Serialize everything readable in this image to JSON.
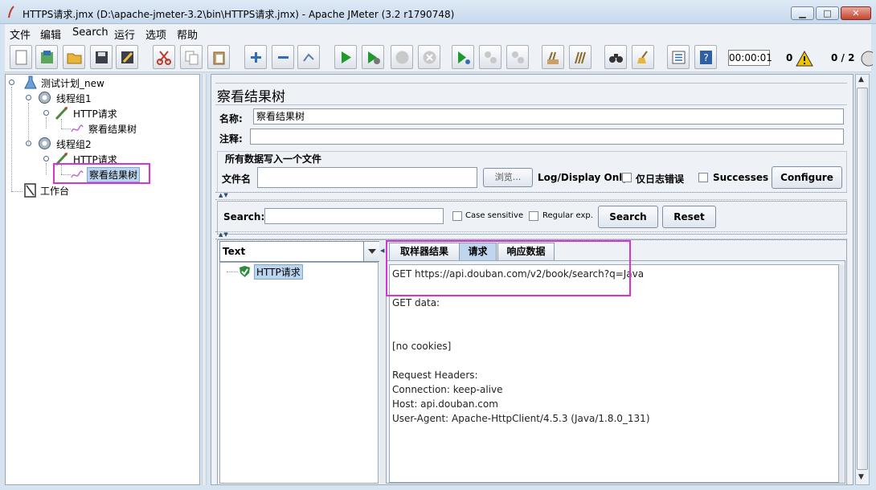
{
  "window": {
    "title": "HTTPS请求.jmx (D:\\apache-jmeter-3.2\\bin\\HTTPS请求.jmx) - Apache JMeter (3.2 r1790748)",
    "min_label": "▁",
    "max_label": "□",
    "close_label": "✕"
  },
  "menu": {
    "items": [
      "文件",
      "编辑",
      "Search",
      "运行",
      "选项",
      "帮助"
    ]
  },
  "toolbar": {
    "icons": [
      "new-icon",
      "templates-icon",
      "open-icon",
      "save-icon",
      "save-as-icon",
      "cut-icon",
      "copy-icon",
      "paste-icon",
      "expand-icon",
      "collapse-icon",
      "toggle-icon",
      "start-icon",
      "start-no-pause-icon",
      "stop-icon",
      "shutdown-icon",
      "remote-start-icon",
      "remote-stop-icon",
      "remote-shutdown-icon",
      "clear-icon",
      "clear-all-icon",
      "search-icon",
      "reset-search-icon",
      "function-helper-icon",
      "help-icon"
    ],
    "timer": "00:00:01",
    "error_count": "0",
    "threads": "0 / 2"
  },
  "tree": {
    "nodes": [
      {
        "label": "测试计划_new",
        "icon": "test-plan-icon"
      },
      {
        "label": "线程组1",
        "icon": "thread-group-icon"
      },
      {
        "label": "HTTP请求",
        "icon": "http-sampler-icon"
      },
      {
        "label": "察看结果树",
        "icon": "result-tree-icon"
      },
      {
        "label": "线程组2",
        "icon": "thread-group-icon"
      },
      {
        "label": "HTTP请求",
        "icon": "http-sampler-icon"
      },
      {
        "label": "察看结果树",
        "icon": "result-tree-icon"
      },
      {
        "label": "工作台",
        "icon": "workbench-icon"
      }
    ]
  },
  "panel": {
    "title": "察看结果树",
    "name_label": "名称:",
    "name_value": "察看结果树",
    "comment_label": "注释:",
    "comment_value": "",
    "file_group_title": "所有数据写入一个文件",
    "filename_label": "文件名",
    "filename_value": "",
    "browse_label": "浏览...",
    "log_display_label": "Log/Display Only:",
    "errors_only_label": "仅日志错误",
    "successes_label": "Successes",
    "configure_label": "Configure"
  },
  "search": {
    "label": "Search:",
    "value": "",
    "case_sensitive_label": "Case sensitive",
    "regex_label": "Regular exp.",
    "search_button": "Search",
    "reset_button": "Reset"
  },
  "results": {
    "renderer": "Text",
    "tree_items": [
      "HTTP请求"
    ],
    "tabs": [
      "取样器结果",
      "请求",
      "响应数据"
    ],
    "active_tab": "请求",
    "request_lines": [
      "GET https://api.douban.com/v2/book/search?q=Java",
      "GET data:",
      "[no cookies]",
      "Request Headers:",
      "Connection: keep-alive",
      "Host: api.douban.com",
      "User-Agent: Apache-HttpClient/4.5.3 (Java/1.8.0_131)"
    ]
  },
  "colors": {
    "highlight": "#d633d6",
    "selection": "#bcd5ee",
    "start_green": "#1f9a2c"
  }
}
